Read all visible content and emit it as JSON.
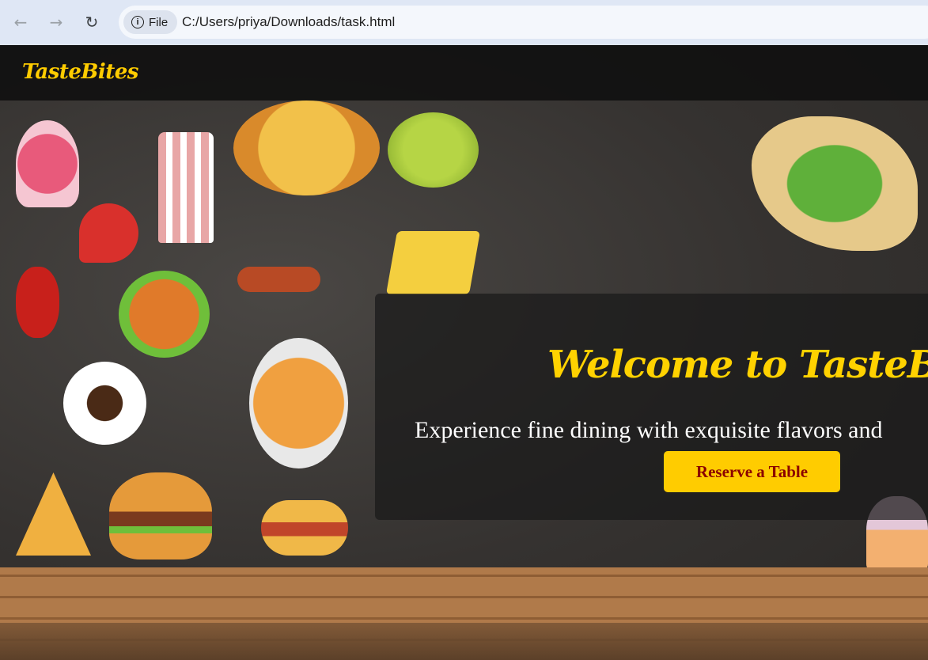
{
  "browser": {
    "back_icon": "arrow-left-icon",
    "forward_icon": "arrow-right-icon",
    "reload_icon": "reload-icon",
    "info_icon": "info-icon",
    "site_chip_label": "File",
    "url": "C:/Users/priya/Downloads/task.html"
  },
  "site": {
    "logo": "TasteBites",
    "accent_color": "#ffcc00"
  },
  "hero": {
    "title": "Welcome to TasteBites",
    "subtitle": "Experience fine dining with exquisite flavors and",
    "cta_label": "Reserve a Table",
    "cta_text_color": "#8b0000"
  }
}
